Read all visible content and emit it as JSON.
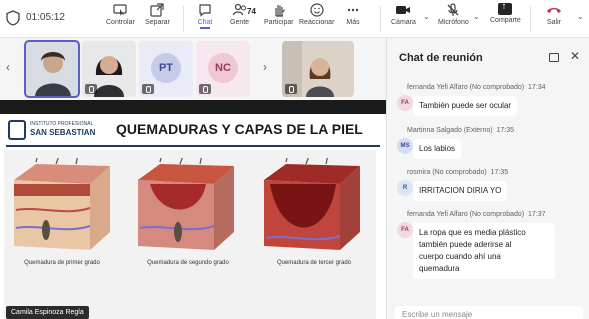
{
  "meeting": {
    "timer": "01:05:12"
  },
  "toolbar": {
    "controlar": "Controlar",
    "separar": "Separar",
    "chat": "Chat",
    "gente": "Gente",
    "gente_count": "74",
    "participar": "Participar",
    "reaccionar": "Reaccionar",
    "mas": "Más",
    "camara": "Cámara",
    "microfono": "Micrófono",
    "compartir": "Comparte",
    "salir": "Salir"
  },
  "participants": [
    {
      "initials": "",
      "muted": false
    },
    {
      "initials": "",
      "muted": true
    },
    {
      "initials": "PT",
      "muted": true
    },
    {
      "initials": "NC",
      "muted": true
    },
    {
      "initials": "",
      "muted": true
    }
  ],
  "slide": {
    "institution_line1": "INSTITUTO PROFESIONAL",
    "institution_line2": "SAN SEBASTIAN",
    "title": "QUEMADURAS Y CAPAS DE LA PIEL",
    "captions": [
      "Quemadura de primer grado",
      "Quemadura de segundo grado",
      "Quemadura de tercer grado"
    ],
    "presenter": "Camila Espinoza Regla"
  },
  "chat": {
    "title": "Chat de reunión",
    "compose_placeholder": "Escribe un mensaje",
    "messages": [
      {
        "author": "fernanda Yefi Alfaro (No comprobado)",
        "time": "17:34",
        "initials": "FA",
        "text": "También puede ser ocular"
      },
      {
        "author": "Martinna Salgado (Externo)",
        "time": "17:35",
        "initials": "MS",
        "text": "Los labios"
      },
      {
        "author": "rosmira (No comprobado)",
        "time": "17:35",
        "initials": "R",
        "text": "IRRITACION DIRIA YO"
      },
      {
        "author": "fernanda Yefi Alfaro (No comprobado)",
        "time": "17:37",
        "initials": "FA",
        "text_lines": [
          "La ropa que es media plástico",
          "también puede aderirse al",
          "cuerpo  cuando ahí una",
          "quemadura"
        ]
      }
    ]
  },
  "colors": {
    "accent": "#5b5fc7",
    "leave": "#c4314b"
  }
}
